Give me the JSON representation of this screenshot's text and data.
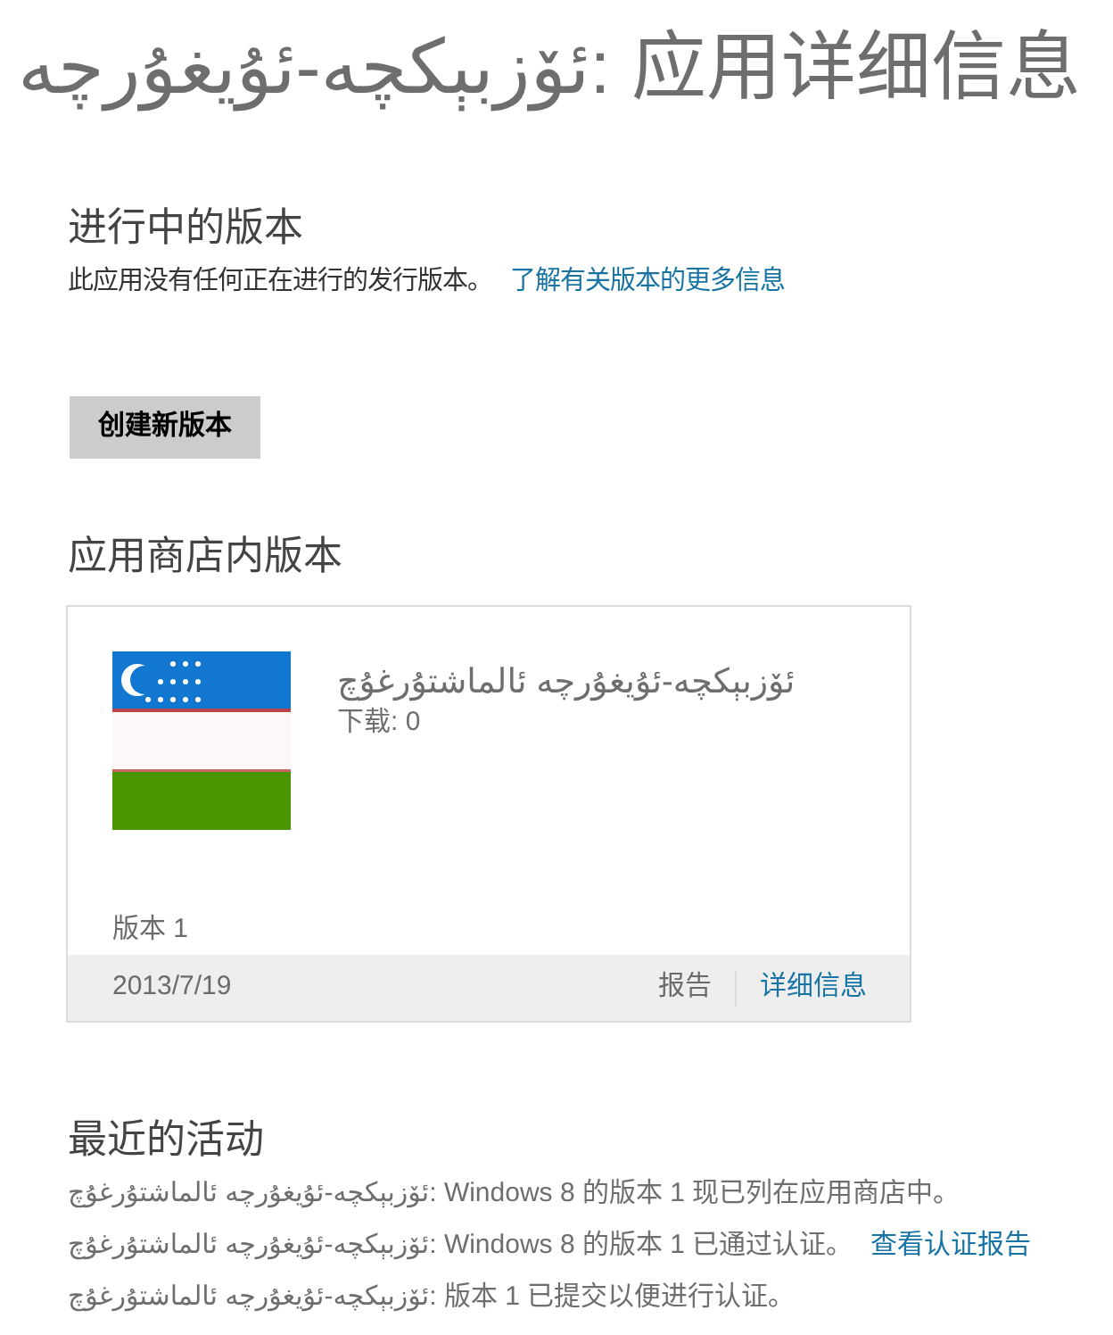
{
  "title": "ئۆزبېكچە-ئۇيغۇرچە: 应用详细信息",
  "in_progress": {
    "heading": "进行中的版本",
    "message": "此应用没有任何正在进行的发行版本。",
    "link": "了解有关版本的更多信息",
    "button": "创建新版本"
  },
  "store_release": {
    "heading": "应用商店内版本",
    "card": {
      "app_name": "ئۆزبېكچە-ئۇيغۇرچە ئالماشتۇرغۇچ",
      "downloads": "下载: 0",
      "version": "版本 1",
      "date": "2013/7/19",
      "report_link": {
        "label": "报告",
        "disabled": true
      },
      "details_link": {
        "label": "详细信息",
        "disabled": false
      }
    }
  },
  "activity": {
    "heading": "最近的活动",
    "items": [
      {
        "text": "ئۆزبېكچە-ئۇيغۇرچە ئالماشتۇرغۇچ: Windows 8 的版本 1 现已列在应用商店中。"
      },
      {
        "text": "ئۆزبېكچە-ئۇيغۇرچە ئالماشتۇرغۇچ: Windows 8 的版本 1 已通过认证。",
        "link": "查看认证报告"
      },
      {
        "text": "ئۆزبېكچە-ئۇيغۇرچە ئالماشتۇرغۇچ: 版本 1 已提交以便进行认证。"
      }
    ]
  }
}
